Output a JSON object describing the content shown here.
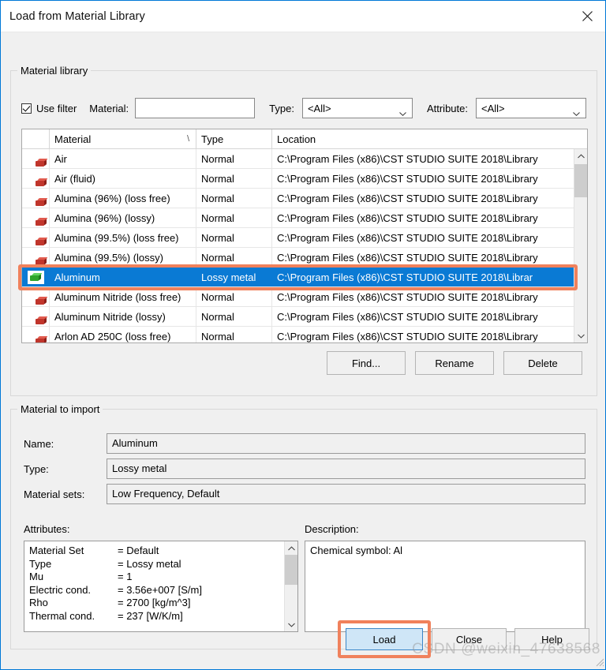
{
  "window": {
    "title": "Load from Material Library",
    "close_icon": "close-icon",
    "accent": "#0078d7"
  },
  "library_group": {
    "label": "Material library",
    "filter": {
      "use_filter_label": "Use filter",
      "use_filter_checked": true,
      "material_label": "Material:",
      "material_value": "",
      "material_placeholder": "",
      "type_label": "Type:",
      "type_value": "<All>",
      "attribute_label": "Attribute:",
      "attribute_value": "<All>"
    },
    "columns": [
      "",
      "Material",
      "Type",
      "Location"
    ],
    "sort_indicator": "/",
    "rows": [
      {
        "icon": "material-cube-icon-red",
        "material": "Air",
        "type": "Normal",
        "location": "C:\\Program Files (x86)\\CST STUDIO SUITE 2018\\Library",
        "selected": false
      },
      {
        "icon": "material-cube-icon-red",
        "material": "Air (fluid)",
        "type": "Normal",
        "location": "C:\\Program Files (x86)\\CST STUDIO SUITE 2018\\Library",
        "selected": false
      },
      {
        "icon": "material-cube-icon-red",
        "material": "Alumina (96%) (loss free)",
        "type": "Normal",
        "location": "C:\\Program Files (x86)\\CST STUDIO SUITE 2018\\Library",
        "selected": false
      },
      {
        "icon": "material-cube-icon-red",
        "material": "Alumina (96%) (lossy)",
        "type": "Normal",
        "location": "C:\\Program Files (x86)\\CST STUDIO SUITE 2018\\Library",
        "selected": false
      },
      {
        "icon": "material-cube-icon-red",
        "material": "Alumina (99.5%) (loss free)",
        "type": "Normal",
        "location": "C:\\Program Files (x86)\\CST STUDIO SUITE 2018\\Library",
        "selected": false
      },
      {
        "icon": "material-cube-icon-red",
        "material": "Alumina (99.5%) (lossy)",
        "type": "Normal",
        "location": "C:\\Program Files (x86)\\CST STUDIO SUITE 2018\\Library",
        "selected": false
      },
      {
        "icon": "material-cube-icon-green",
        "material": "Aluminum",
        "type": "Lossy metal",
        "location": "C:\\Program Files (x86)\\CST STUDIO SUITE 2018\\Librar",
        "selected": true
      },
      {
        "icon": "material-cube-icon-red",
        "material": "Aluminum Nitride (loss free)",
        "type": "Normal",
        "location": "C:\\Program Files (x86)\\CST STUDIO SUITE 2018\\Library",
        "selected": false
      },
      {
        "icon": "material-cube-icon-red",
        "material": "Aluminum Nitride (lossy)",
        "type": "Normal",
        "location": "C:\\Program Files (x86)\\CST STUDIO SUITE 2018\\Library",
        "selected": false
      },
      {
        "icon": "material-cube-icon-red",
        "material": "Arlon AD 250C (loss free)",
        "type": "Normal",
        "location": "C:\\Program Files (x86)\\CST STUDIO SUITE 2018\\Library",
        "selected": false
      }
    ],
    "buttons": {
      "find": "Find...",
      "rename": "Rename",
      "delete": "Delete"
    }
  },
  "import_group": {
    "label": "Material to import",
    "name_label": "Name:",
    "name_value": "Aluminum",
    "type_label": "Type:",
    "type_value": "Lossy metal",
    "sets_label": "Material sets:",
    "sets_value": "Low Frequency, Default",
    "attributes_label": "Attributes:",
    "attributes": [
      {
        "key": "Material Set",
        "value": "= Default"
      },
      {
        "key": "Type",
        "value": "= Lossy metal"
      },
      {
        "key": "Mu",
        "value": "= 1"
      },
      {
        "key": "Electric cond.",
        "value": "= 3.56e+007 [S/m]"
      },
      {
        "key": "Rho",
        "value": "= 2700 [kg/m^3]"
      },
      {
        "key": "Thermal cond.",
        "value": "= 237 [W/K/m]"
      }
    ],
    "description_label": "Description:",
    "description_text": "Chemical symbol: Al"
  },
  "footer": {
    "load": "Load",
    "close": "Close",
    "help": "Help"
  },
  "watermark": "CSDN @weixin_47638568",
  "annotation_color": "#f0815c",
  "selection_color": "#0a7ad4"
}
